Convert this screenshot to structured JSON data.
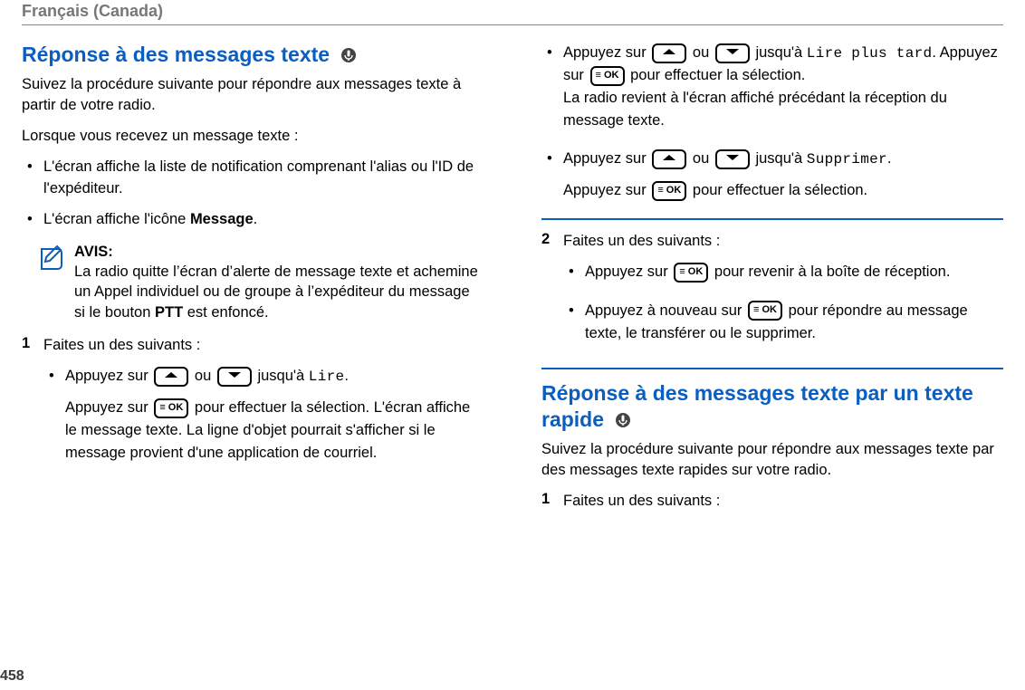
{
  "header": {
    "lang": "Français (Canada)"
  },
  "page_number": "458",
  "labels": {
    "avis": "AVIS:"
  },
  "left": {
    "title": "Réponse à des messages texte",
    "intro": "Suivez la procédure suivante pour répondre aux messages texte à partir de votre radio.",
    "when": "Lorsque vous recevez un message texte :",
    "b1": "L'écran affiche la liste de notification comprenant l'alias ou l'ID de l'expéditeur.",
    "b2_pre": "L'écran affiche l'icône ",
    "b2_bold": "Message",
    "b2_post": ".",
    "avis_pre": "La radio quitte l’écran d’alerte de message texte et achemine un Appel individuel ou de groupe à l’expéditeur du message si le bouton ",
    "avis_bold": "PTT",
    "avis_post": " est enfoncé.",
    "step1": "Faites un des suivants :",
    "s1a_pre": "Appuyez sur ",
    "s1a_mid": " ou ",
    "s1a_mid2": " jusqu'à ",
    "s1a_mono": "Lire",
    "s1a_post": ".",
    "s1a_line2_pre": "Appuyez sur ",
    "s1a_line2_post": " pour effectuer la sélection. L'écran affiche le message texte. La ligne d'objet pourrait s'afficher si le message provient d'une application de courriel."
  },
  "right": {
    "r1_pre": "Appuyez sur ",
    "r1_mid": " ou ",
    "r1_mid2": " jusqu'à ",
    "r1_mono": "Lire plus tard",
    "r1_l2_pre": ". Appuyez sur ",
    "r1_l2_post": " pour effectuer la sélection.",
    "r1_l3": "La radio revient à l'écran affiché précédant la réception du message texte.",
    "r2_pre": "Appuyez sur ",
    "r2_mid": " ou ",
    "r2_mid2": " jusqu'à ",
    "r2_mono": "Supprimer",
    "r2_post": ".",
    "r2_l2_pre": "Appuyez sur ",
    "r2_l2_post": " pour effectuer la sélection.",
    "step2": "Faites un des suivants :",
    "s2a_pre": "Appuyez sur ",
    "s2a_post": " pour revenir à la boîte de réception.",
    "s2b_pre": "Appuyez à nouveau sur ",
    "s2b_post": " pour répondre au message texte, le transférer ou le supprimer.",
    "title2": "Réponse à des messages texte par un texte rapide",
    "intro2": "Suivez la procédure suivante pour répondre aux messages texte par des messages texte rapides sur votre radio.",
    "step1b": "Faites un des suivants :"
  },
  "icons": {
    "up": "up-arrow",
    "down": "down-arrow",
    "ok": "menu-ok",
    "mic": "radio-mic",
    "note": "note"
  },
  "key_ok_label": "≡ OK"
}
